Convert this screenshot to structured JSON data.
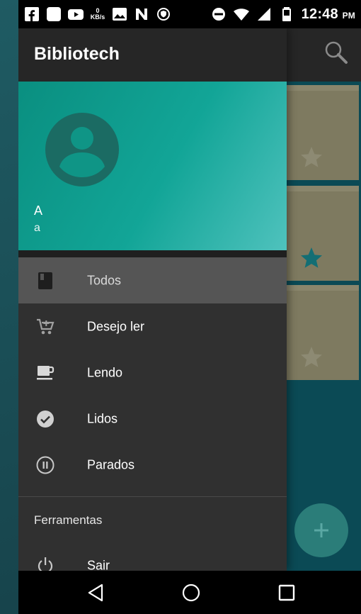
{
  "status_bar": {
    "kb_value": "0",
    "kb_unit": "KB/s",
    "time": "12:48",
    "time_suffix": "PM"
  },
  "app": {
    "title": "Bibliotech"
  },
  "drawer": {
    "user_name": "A",
    "user_email": "a",
    "items": [
      {
        "label": "Todos",
        "icon": "book-icon",
        "active": true
      },
      {
        "label": "Desejo ler",
        "icon": "add-cart-icon"
      },
      {
        "label": "Lendo",
        "icon": "coffee-cup-icon"
      },
      {
        "label": "Lidos",
        "icon": "check-circle-icon"
      },
      {
        "label": "Parados",
        "icon": "pause-circle-icon"
      }
    ],
    "section_title": "Ferramentas",
    "logout_label": "Sair"
  },
  "colors": {
    "header_start": "#0a8f80",
    "header_end": "#4fc2bd",
    "drawer_bg": "#303030",
    "active_item_bg": "#555555",
    "fab": "#2b7d79"
  }
}
